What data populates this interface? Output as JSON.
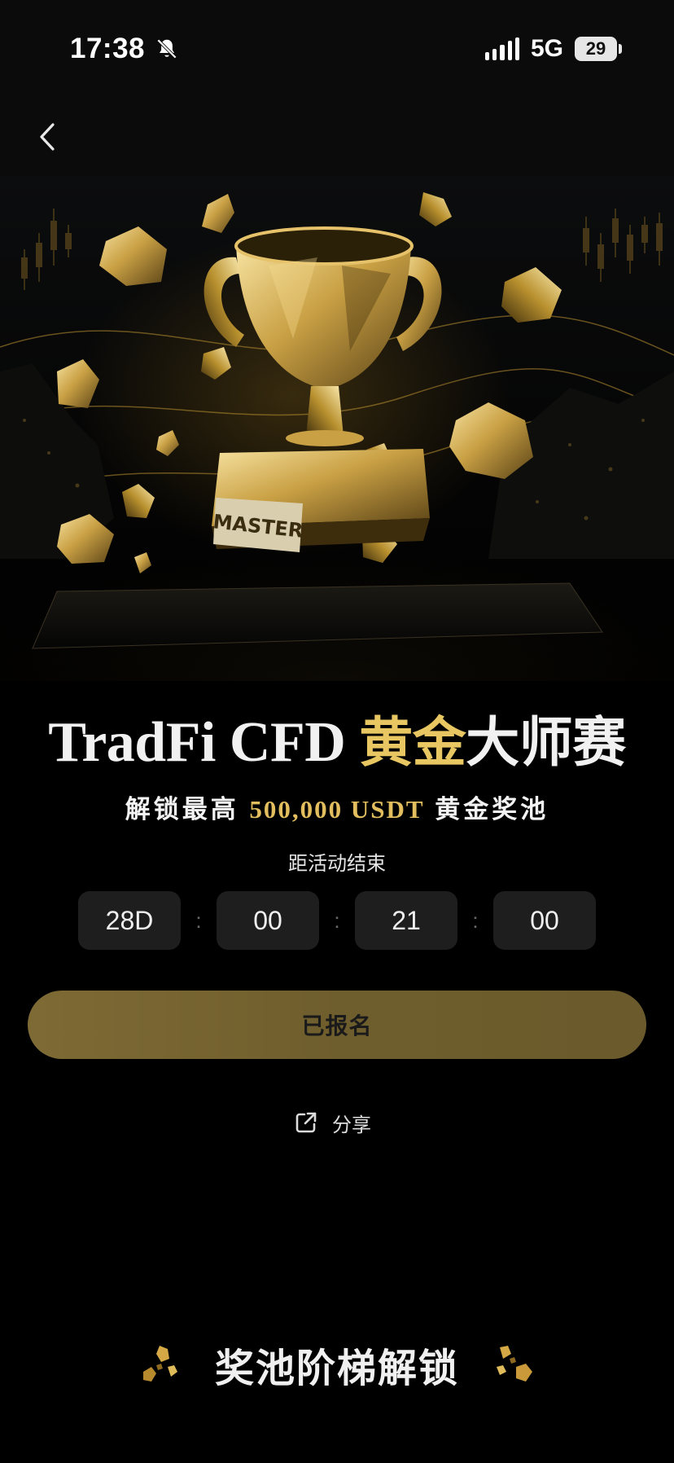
{
  "status_bar": {
    "time": "17:38",
    "network": "5G",
    "battery": "29",
    "icons": [
      "bell-muted-icon",
      "signal-icon",
      "battery-icon"
    ]
  },
  "nav": {
    "back_icon": "chevron-left-icon"
  },
  "hero": {
    "trophy_label": "MASTER",
    "icons": [
      "trophy-icon",
      "gold-nugget-icon"
    ]
  },
  "title": {
    "latin": "TradFi CFD ",
    "gold": "黄金",
    "rest": "大师赛"
  },
  "subtitle": {
    "prefix": "解锁最高 ",
    "amount": "500,000 USDT",
    "suffix": " 黄金奖池"
  },
  "countdown": {
    "label": "距活动结束",
    "days": "28D",
    "hours": "00",
    "minutes": "21",
    "seconds": "00",
    "separator": ":"
  },
  "cta": {
    "registered_label": "已报名"
  },
  "share": {
    "label": "分享",
    "icon": "share-icon"
  },
  "section": {
    "title": "奖池阶梯解锁",
    "icon": "gold-nugget-icon"
  },
  "colors": {
    "gold_accent": "#e8c661",
    "button_gold": "#766434",
    "countdown_box": "#1e1e1e",
    "background": "#000000"
  }
}
